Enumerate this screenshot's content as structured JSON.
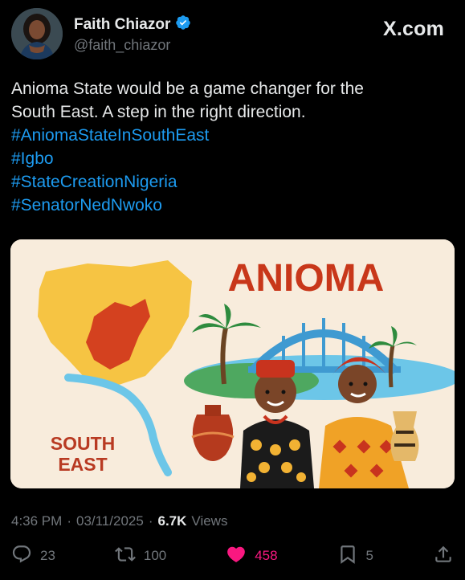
{
  "author": {
    "name": "Faith Chiazor",
    "handle": "@faith_chiazor",
    "verified": true
  },
  "brand": "X.com",
  "tweet": {
    "text_lines": [
      "Anioma State would be a game changer for the",
      "South East. A step in the right direction."
    ],
    "hashtags": [
      "#AniomaStateInSouthEast",
      "#Igbo",
      "#StateCreationNigeria",
      "#SenatorNedNwoko"
    ]
  },
  "media": {
    "headline": "ANIOMA",
    "region_line1": "SOUTH",
    "region_line2": "EAST"
  },
  "meta": {
    "time": "4:36 PM",
    "separator": "·",
    "date": "03/11/2025",
    "views_count": "6.7K",
    "views_label": "Views"
  },
  "actions": {
    "replies": "23",
    "reposts": "100",
    "likes": "458",
    "bookmarks": "5"
  },
  "colors": {
    "background": "#000000",
    "text": "#e7e9ea",
    "muted": "#71767b",
    "link": "#1d9bf0",
    "like": "#f91880",
    "verified": "#1d9bf0"
  },
  "icons": [
    "verified-badge-icon",
    "reply-icon",
    "repost-icon",
    "like-heart-icon",
    "bookmark-icon",
    "share-icon"
  ]
}
